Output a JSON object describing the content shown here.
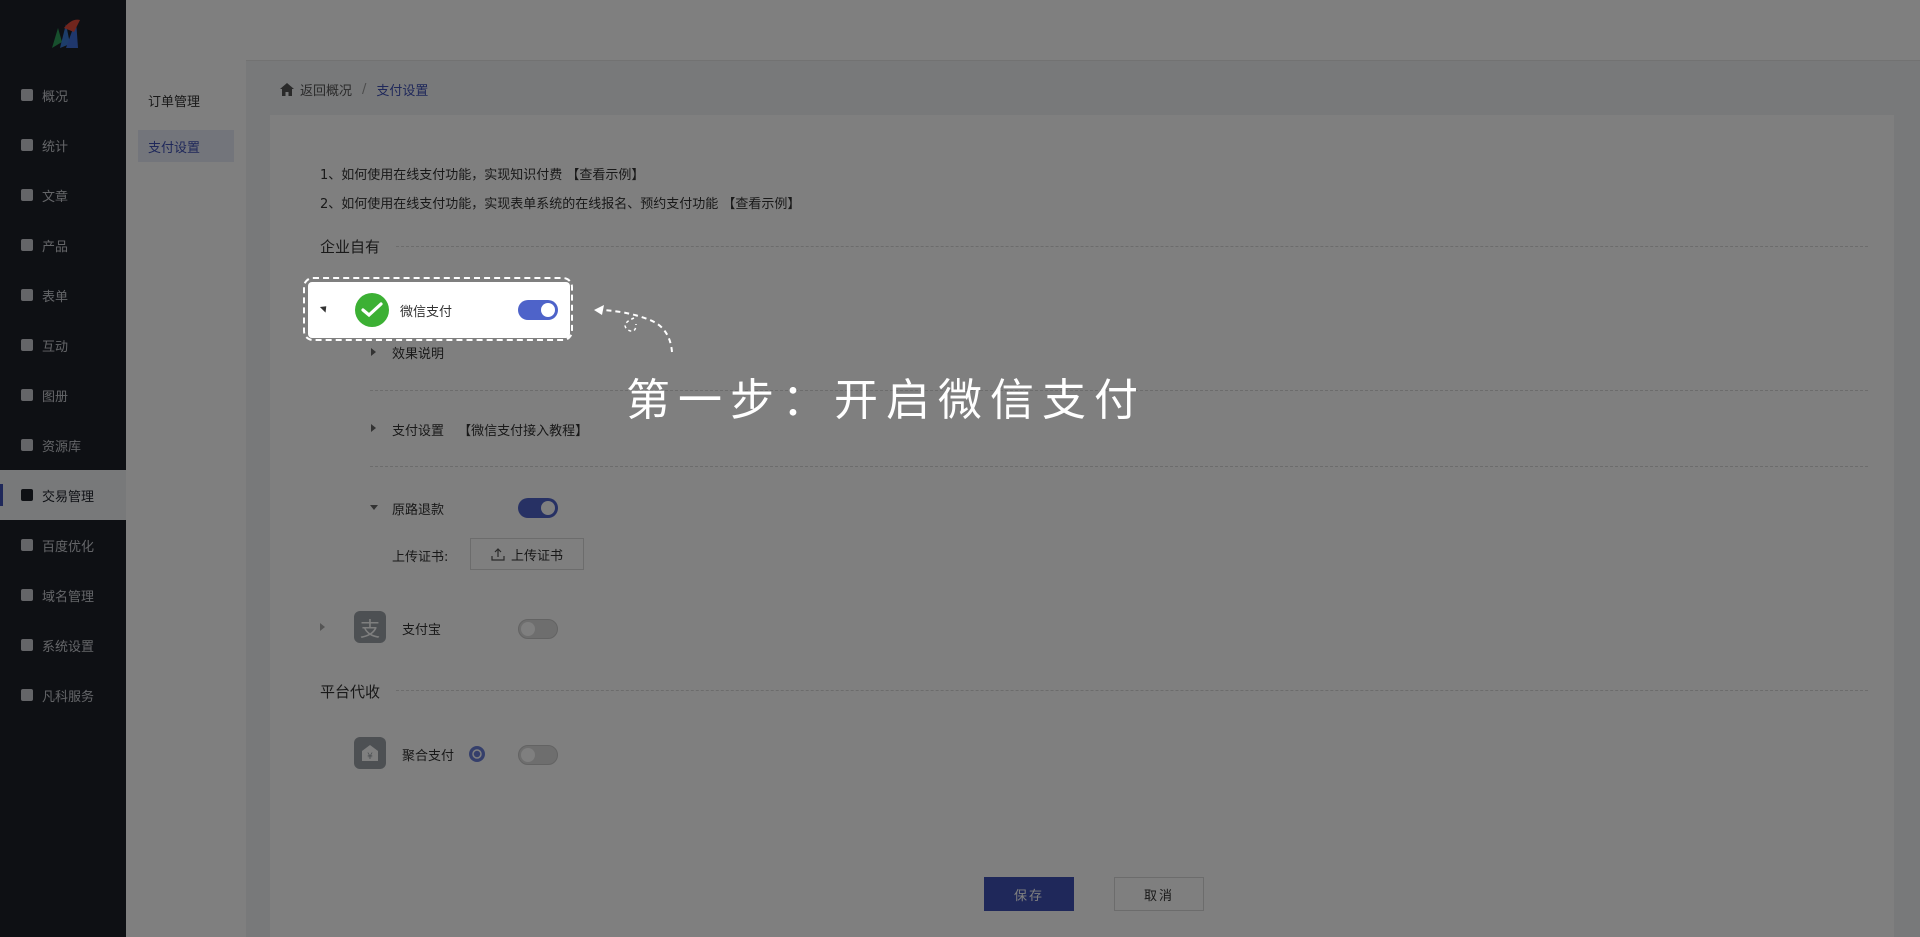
{
  "sidebar": {
    "items": [
      {
        "label": "概况",
        "icon": "home-icon"
      },
      {
        "label": "统计",
        "icon": "chart-icon"
      },
      {
        "label": "文章",
        "icon": "article-icon"
      },
      {
        "label": "产品",
        "icon": "product-grid-icon"
      },
      {
        "label": "表单",
        "icon": "form-icon"
      },
      {
        "label": "互动",
        "icon": "comment-icon"
      },
      {
        "label": "图册",
        "icon": "album-icon"
      },
      {
        "label": "资源库",
        "icon": "database-icon"
      },
      {
        "label": "交易管理",
        "icon": "clipboard-icon",
        "active": true
      },
      {
        "label": "百度优化",
        "icon": "seo-icon"
      },
      {
        "label": "域名管理",
        "icon": "domain-icon"
      },
      {
        "label": "系统设置",
        "icon": "gear-icon"
      },
      {
        "label": "凡科服务",
        "icon": "heart-icon"
      }
    ]
  },
  "subnav": {
    "items": [
      {
        "label": "订单管理"
      },
      {
        "label": "支付设置",
        "active": true
      }
    ]
  },
  "breadcrumb": {
    "back": "返回概况",
    "separator": "/",
    "current": "支付设置"
  },
  "tips": [
    {
      "text": "1、如何使用在线支付功能，实现知识付费",
      "link": "【查看示例】"
    },
    {
      "text": "2、如何使用在线支付功能，实现表单系统的在线报名、预约支付功能",
      "link": "【查看示例】"
    }
  ],
  "sections": {
    "enterprise": "企业自有",
    "platform": "平台代收"
  },
  "wechat": {
    "name": "微信支付",
    "enabled": true,
    "effect_label": "效果说明",
    "settings_label": "支付设置",
    "settings_link": "【微信支付接入教程】",
    "refund_label": "原路退款",
    "refund_enabled": true,
    "cert_label": "上传证书:",
    "cert_button": "上传证书"
  },
  "alipay": {
    "name": "支付宝",
    "enabled": false,
    "icon_char": "支"
  },
  "aggregate": {
    "name": "聚合支付",
    "enabled": false
  },
  "actions": {
    "save": "保存",
    "cancel": "取消"
  },
  "guide": {
    "step_text": "第一步：开启微信支付"
  },
  "colors": {
    "primary": "#3f51b5",
    "toggle_on": "#4e63c9",
    "wechat_green": "#3cb034",
    "sidebar_bg": "#1d2129"
  }
}
